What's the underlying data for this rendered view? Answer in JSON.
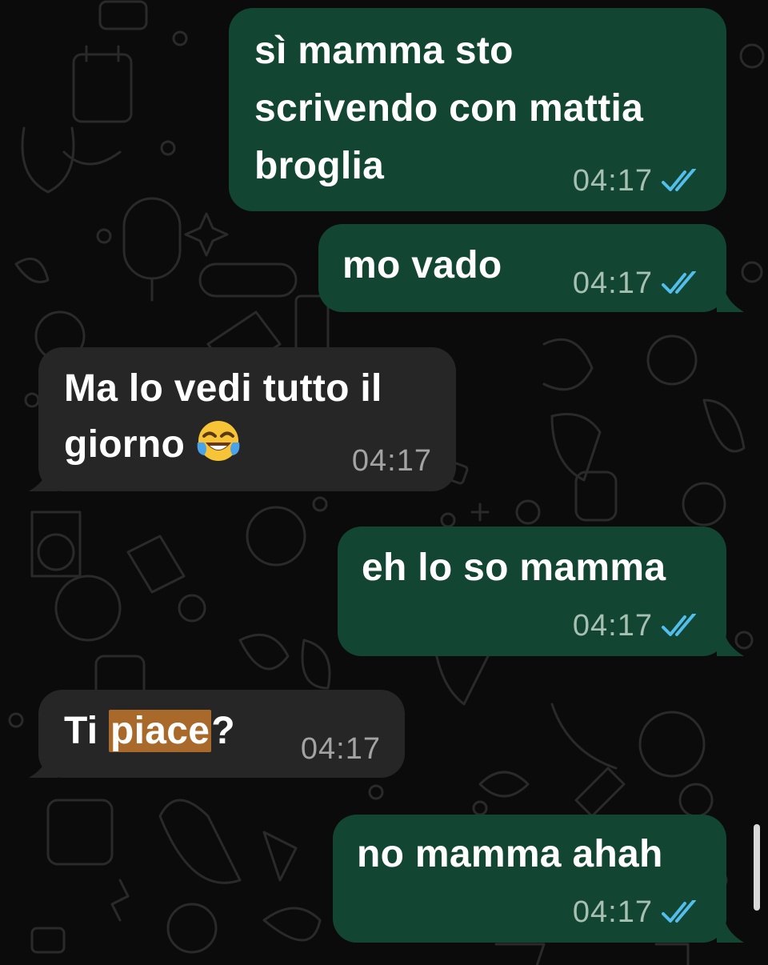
{
  "chat": {
    "colors": {
      "outgoing_bubble": "#124632",
      "incoming_bubble": "#262626",
      "read_ticks": "#53bdeb",
      "highlight": "#a8692a",
      "background": "#0b0b0b"
    },
    "messages": [
      {
        "direction": "outgoing",
        "text": "sì mamma sto\nscrivendo con mattia\nbroglia",
        "time": "04:17",
        "status": "read"
      },
      {
        "direction": "outgoing",
        "text": "mo vado",
        "time": "04:17",
        "status": "read"
      },
      {
        "direction": "incoming",
        "text_line1": "Ma lo vedi tutto il",
        "text_line2": "giorno",
        "emoji": "face-with-tears-of-joy",
        "time": "04:17"
      },
      {
        "direction": "outgoing",
        "text": "eh lo so mamma",
        "time": "04:17",
        "status": "read"
      },
      {
        "direction": "incoming",
        "text_before": "Ti ",
        "text_highlight": "piace",
        "text_after": "?",
        "time": "04:17"
      },
      {
        "direction": "outgoing",
        "text": "no mamma ahah",
        "time": "04:17",
        "status": "read"
      }
    ]
  }
}
